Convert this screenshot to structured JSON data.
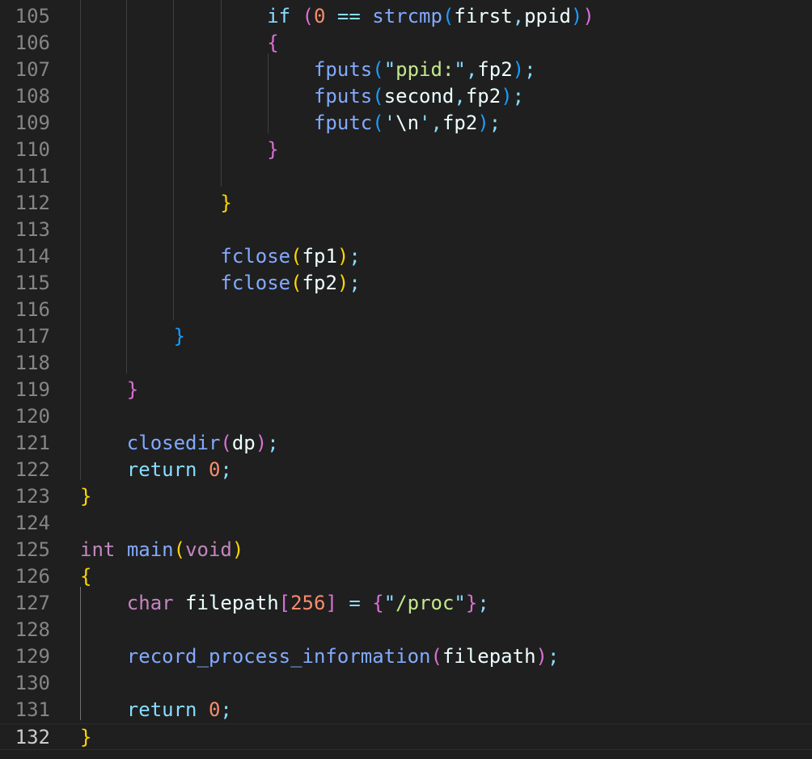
{
  "editor": {
    "language": "c",
    "line_numbers": [
      "105",
      "106",
      "107",
      "108",
      "109",
      "110",
      "111",
      "112",
      "113",
      "114",
      "115",
      "116",
      "117",
      "118",
      "119",
      "120",
      "121",
      "122",
      "123",
      "124",
      "125",
      "126",
      "127",
      "128",
      "129",
      "130",
      "131",
      "132"
    ],
    "current_line": "132",
    "lines": [
      {
        "n": "105",
        "tokens": [
          {
            "t": "                ",
            "c": "plain"
          },
          {
            "t": "if",
            "c": "ret"
          },
          {
            "t": " ",
            "c": "plain"
          },
          {
            "t": "(",
            "c": "b2"
          },
          {
            "t": "0",
            "c": "num"
          },
          {
            "t": " == ",
            "c": "op"
          },
          {
            "t": "strcmp",
            "c": "fn"
          },
          {
            "t": "(",
            "c": "b3"
          },
          {
            "t": "first",
            "c": "id"
          },
          {
            "t": ",",
            "c": "op"
          },
          {
            "t": "ppid",
            "c": "id"
          },
          {
            "t": ")",
            "c": "b3"
          },
          {
            "t": ")",
            "c": "b2"
          }
        ]
      },
      {
        "n": "106",
        "tokens": [
          {
            "t": "                ",
            "c": "plain"
          },
          {
            "t": "{",
            "c": "b2"
          }
        ]
      },
      {
        "n": "107",
        "tokens": [
          {
            "t": "                    ",
            "c": "plain"
          },
          {
            "t": "fputs",
            "c": "fn"
          },
          {
            "t": "(",
            "c": "b3"
          },
          {
            "t": "\"",
            "c": "op"
          },
          {
            "t": "ppid:",
            "c": "str"
          },
          {
            "t": "\"",
            "c": "op"
          },
          {
            "t": ",",
            "c": "op"
          },
          {
            "t": "fp2",
            "c": "id"
          },
          {
            "t": ")",
            "c": "b3"
          },
          {
            "t": ";",
            "c": "op"
          }
        ]
      },
      {
        "n": "108",
        "tokens": [
          {
            "t": "                    ",
            "c": "plain"
          },
          {
            "t": "fputs",
            "c": "fn"
          },
          {
            "t": "(",
            "c": "b3"
          },
          {
            "t": "second",
            "c": "id"
          },
          {
            "t": ",",
            "c": "op"
          },
          {
            "t": "fp2",
            "c": "id"
          },
          {
            "t": ")",
            "c": "b3"
          },
          {
            "t": ";",
            "c": "op"
          }
        ]
      },
      {
        "n": "109",
        "tokens": [
          {
            "t": "                    ",
            "c": "plain"
          },
          {
            "t": "fputc",
            "c": "fn"
          },
          {
            "t": "(",
            "c": "b3"
          },
          {
            "t": "'",
            "c": "op"
          },
          {
            "t": "\\n",
            "c": "id"
          },
          {
            "t": "'",
            "c": "op"
          },
          {
            "t": ",",
            "c": "op"
          },
          {
            "t": "fp2",
            "c": "id"
          },
          {
            "t": ")",
            "c": "b3"
          },
          {
            "t": ";",
            "c": "op"
          }
        ]
      },
      {
        "n": "110",
        "tokens": [
          {
            "t": "                ",
            "c": "plain"
          },
          {
            "t": "}",
            "c": "b2"
          }
        ]
      },
      {
        "n": "111",
        "tokens": []
      },
      {
        "n": "112",
        "tokens": [
          {
            "t": "            ",
            "c": "plain"
          },
          {
            "t": "}",
            "c": "b1"
          }
        ]
      },
      {
        "n": "113",
        "tokens": []
      },
      {
        "n": "114",
        "tokens": [
          {
            "t": "            ",
            "c": "plain"
          },
          {
            "t": "fclose",
            "c": "fn"
          },
          {
            "t": "(",
            "c": "b1"
          },
          {
            "t": "fp1",
            "c": "id"
          },
          {
            "t": ")",
            "c": "b1"
          },
          {
            "t": ";",
            "c": "op"
          }
        ]
      },
      {
        "n": "115",
        "tokens": [
          {
            "t": "            ",
            "c": "plain"
          },
          {
            "t": "fclose",
            "c": "fn"
          },
          {
            "t": "(",
            "c": "b1"
          },
          {
            "t": "fp2",
            "c": "id"
          },
          {
            "t": ")",
            "c": "b1"
          },
          {
            "t": ";",
            "c": "op"
          }
        ]
      },
      {
        "n": "116",
        "tokens": []
      },
      {
        "n": "117",
        "tokens": [
          {
            "t": "        ",
            "c": "plain"
          },
          {
            "t": "}",
            "c": "b3"
          }
        ]
      },
      {
        "n": "118",
        "tokens": []
      },
      {
        "n": "119",
        "tokens": [
          {
            "t": "    ",
            "c": "plain"
          },
          {
            "t": "}",
            "c": "b2"
          }
        ]
      },
      {
        "n": "120",
        "tokens": []
      },
      {
        "n": "121",
        "tokens": [
          {
            "t": "    ",
            "c": "plain"
          },
          {
            "t": "closedir",
            "c": "fn"
          },
          {
            "t": "(",
            "c": "b2"
          },
          {
            "t": "dp",
            "c": "id"
          },
          {
            "t": ")",
            "c": "b2"
          },
          {
            "t": ";",
            "c": "op"
          }
        ]
      },
      {
        "n": "122",
        "tokens": [
          {
            "t": "    ",
            "c": "plain"
          },
          {
            "t": "return",
            "c": "ret"
          },
          {
            "t": " ",
            "c": "plain"
          },
          {
            "t": "0",
            "c": "num"
          },
          {
            "t": ";",
            "c": "op"
          }
        ]
      },
      {
        "n": "123",
        "tokens": [
          {
            "t": "}",
            "c": "b1"
          }
        ]
      },
      {
        "n": "124",
        "tokens": []
      },
      {
        "n": "125",
        "tokens": [
          {
            "t": "int",
            "c": "ty"
          },
          {
            "t": " ",
            "c": "plain"
          },
          {
            "t": "main",
            "c": "fn"
          },
          {
            "t": "(",
            "c": "b1"
          },
          {
            "t": "void",
            "c": "ty"
          },
          {
            "t": ")",
            "c": "b1"
          }
        ]
      },
      {
        "n": "126",
        "tokens": [
          {
            "t": "{",
            "c": "b1"
          }
        ]
      },
      {
        "n": "127",
        "tokens": [
          {
            "t": "    ",
            "c": "plain"
          },
          {
            "t": "char",
            "c": "ty"
          },
          {
            "t": " ",
            "c": "plain"
          },
          {
            "t": "filepath",
            "c": "id"
          },
          {
            "t": "[",
            "c": "b2"
          },
          {
            "t": "256",
            "c": "num"
          },
          {
            "t": "]",
            "c": "b2"
          },
          {
            "t": " = ",
            "c": "op"
          },
          {
            "t": "{",
            "c": "b2"
          },
          {
            "t": "\"",
            "c": "op"
          },
          {
            "t": "/proc",
            "c": "str"
          },
          {
            "t": "\"",
            "c": "op"
          },
          {
            "t": "}",
            "c": "b2"
          },
          {
            "t": ";",
            "c": "op"
          }
        ]
      },
      {
        "n": "128",
        "tokens": []
      },
      {
        "n": "129",
        "tokens": [
          {
            "t": "    ",
            "c": "plain"
          },
          {
            "t": "record_process_information",
            "c": "fn"
          },
          {
            "t": "(",
            "c": "b2"
          },
          {
            "t": "filepath",
            "c": "id"
          },
          {
            "t": ")",
            "c": "b2"
          },
          {
            "t": ";",
            "c": "op"
          }
        ]
      },
      {
        "n": "130",
        "tokens": []
      },
      {
        "n": "131",
        "tokens": [
          {
            "t": "    ",
            "c": "plain"
          },
          {
            "t": "return",
            "c": "ret"
          },
          {
            "t": " ",
            "c": "plain"
          },
          {
            "t": "0",
            "c": "num"
          },
          {
            "t": ";",
            "c": "op"
          }
        ]
      },
      {
        "n": "132",
        "tokens": [
          {
            "t": "}",
            "c": "b1"
          }
        ]
      }
    ],
    "colors": {
      "background": "#1f1f1f",
      "line_number": "#858585",
      "active_line_number": "#cccccc",
      "bracket_level1": "#ffd700",
      "bracket_level2": "#da70d6",
      "bracket_level3": "#179fff"
    }
  }
}
